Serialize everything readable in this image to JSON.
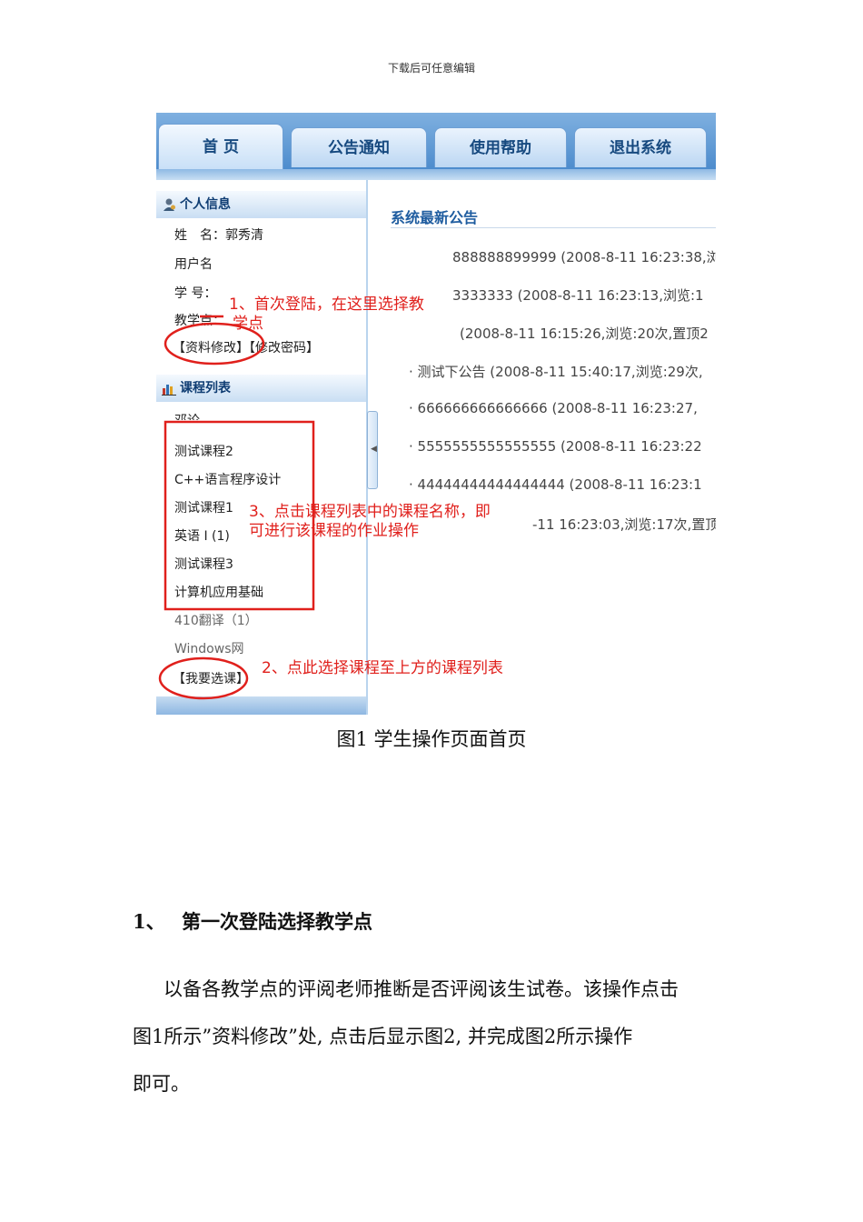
{
  "header_note": "下载后可任意编辑",
  "figure": {
    "tabs": [
      "首 页",
      "公告通知",
      "使用帮助",
      "退出系统"
    ],
    "personal_info": {
      "title": "个人信息",
      "name_row": "姓　名：郭秀清",
      "username_row": "用户名",
      "student_id_row": "学 号：",
      "teaching_point_row": "教学点：",
      "links": [
        "【资料修改】",
        "【修改密码】"
      ]
    },
    "course_list": {
      "title": "课程列表",
      "items": [
        "邓论",
        "测试课程2",
        "C++语言程序设计",
        "测试课程1",
        "英语 I (1)",
        "测试课程3",
        "计算机应用基础",
        "410翻译（1）",
        "Windows网"
      ],
      "select_link": "【我要选课】"
    },
    "notices": {
      "title": "系统最新公告",
      "items": [
        "888888899999  (2008-8-11 16:23:38,浏",
        "3333333  (2008-8-11 16:23:13,浏览:1",
        "(2008-8-11 16:15:26,浏览:20次,置顶2",
        "· 测试下公告  (2008-8-11 15:40:17,浏览:29次,",
        "· 666666666666666  (2008-8-11 16:23:27,",
        "· 5555555555555555  (2008-8-11 16:23:22",
        "· 44444444444444444  (2008-8-11 16:23:1",
        "-11 16:23:03,浏览:17次,置顶"
      ]
    },
    "annotations": {
      "a1_line1": "1、首次登陆，在这里选择教",
      "a1_line2": "学点",
      "a2": "2、点此选择课程至上方的课程列表",
      "a3_line1": "3、点击课程列表中的课程名称，即",
      "a3_line2": "可进行该课程的作业操作"
    },
    "annotation_color": "#e0201c"
  },
  "caption": "图1  学生操作页面首页",
  "section": {
    "number": "1、",
    "title": "第一次登陆选择教学点"
  },
  "paragraph": {
    "line1": "以备各教学点的评阅老师推断是否评阅该生试卷。该操作点击",
    "line2": "图1所示”资料修改”处, 点击后显示图2, 并完成图2所示操作",
    "line3": "即可。"
  }
}
